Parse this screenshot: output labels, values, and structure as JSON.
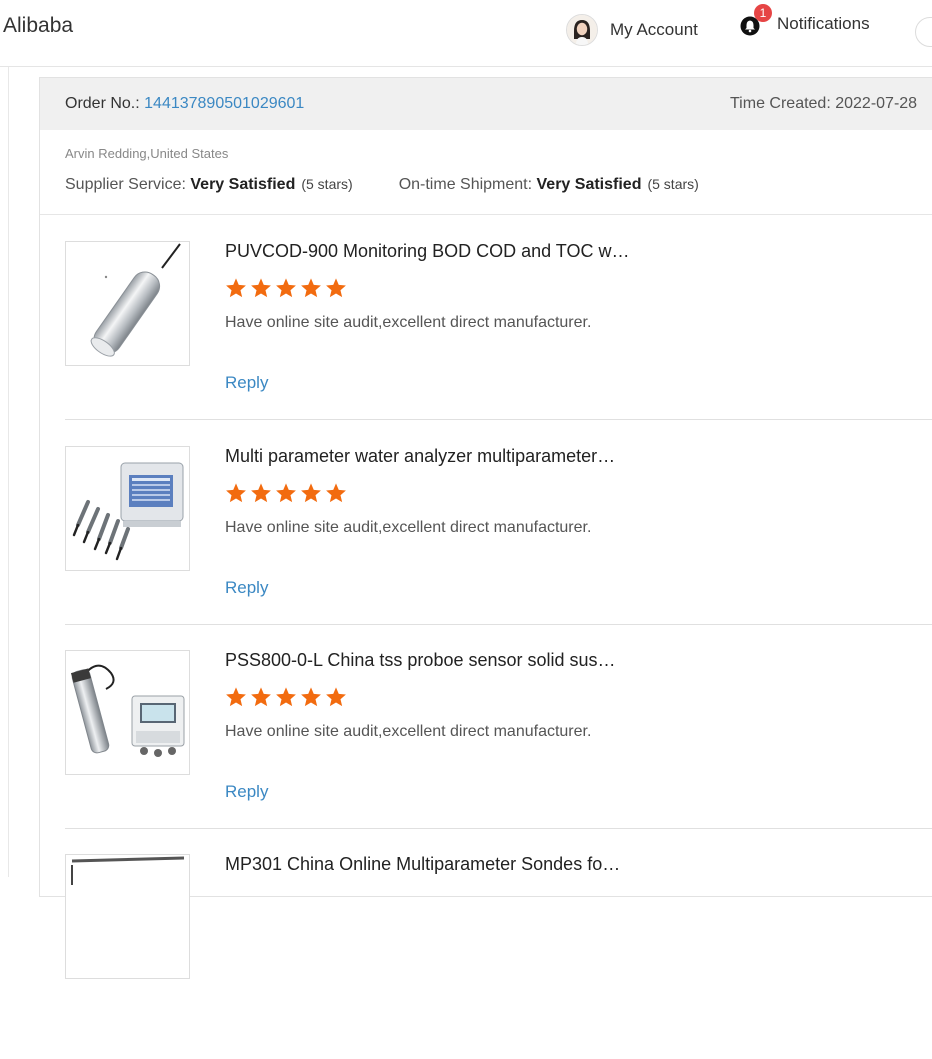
{
  "header": {
    "logo": "Alibaba",
    "account_label": "My Account",
    "notifications_label": "Notifications",
    "notifications_count": "1"
  },
  "order": {
    "order_no_label": "Order No.: ",
    "order_no": "144137890501029601",
    "time_created": "Time Created: 2022-07-28",
    "buyer": "Arvin Redding,United States",
    "supplier_service_label": "Supplier Service: ",
    "supplier_service_value": "Very Satisfied",
    "supplier_service_stars": "(5 stars)",
    "shipment_label": "On-time Shipment: ",
    "shipment_value": "Very Satisfied",
    "shipment_stars": "(5 stars)"
  },
  "reviews": [
    {
      "title": "PUVCOD-900 Monitoring BOD COD and TOC w…",
      "rating": 5,
      "comment": "Have online site audit,excellent direct manufacturer.",
      "reply": "Reply"
    },
    {
      "title": "Multi parameter water analyzer multiparameter…",
      "rating": 5,
      "comment": "Have online site audit,excellent direct manufacturer.",
      "reply": "Reply"
    },
    {
      "title": "PSS800-0-L China tss proboe sensor solid sus…",
      "rating": 5,
      "comment": "Have online site audit,excellent direct manufacturer.",
      "reply": "Reply"
    },
    {
      "title": "MP301 China Online Multiparameter Sondes fo…"
    }
  ],
  "colors": {
    "link": "#3b88c3",
    "star": "#f26b0f",
    "badge": "#e64545",
    "header_bg": "#f0f0f0"
  }
}
